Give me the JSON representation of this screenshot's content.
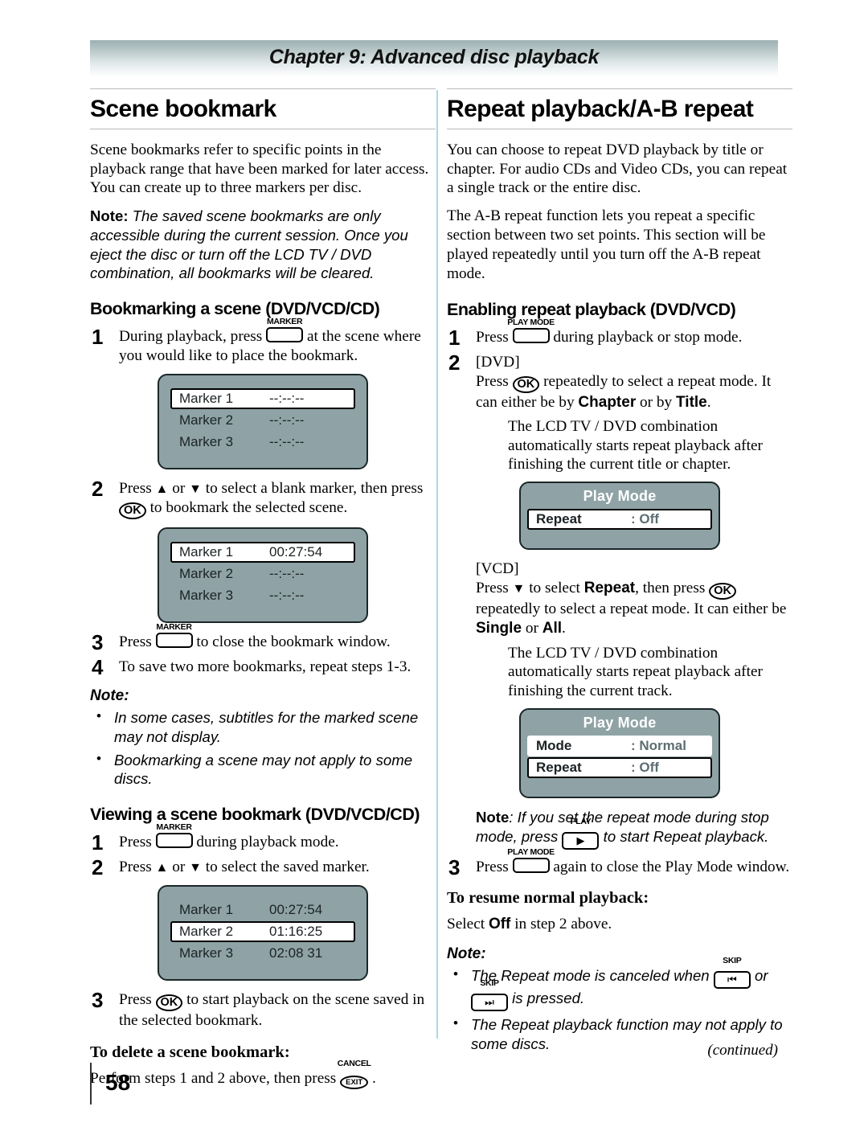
{
  "header": {
    "chapter_title": "Chapter 9: Advanced disc playback"
  },
  "footer": {
    "page_number": "58",
    "continued": "(continued)"
  },
  "left_column": {
    "section_title": "Scene bookmark",
    "intro_paragraph": "Scene bookmarks refer to specific points in the playback range that have been marked for later access. You can create up to three markers per disc.",
    "note_label": "Note:",
    "note_text": " The saved scene bookmarks are only accessible during the current session. Once you eject the disc or turn off the LCD TV / DVD combination, all bookmarks will be cleared.",
    "subsection_title": "Bookmarking a scene (DVD/VCD/CD)",
    "step1_num": "1",
    "step1_pre": "During playback, press ",
    "step1_key": "MARKER",
    "step1_post": " at the scene where you would like to place the bookmark.",
    "step2_num": "2",
    "step2_pre": "Press ",
    "step2_mid": " or ",
    "step2_post": " to select a blank marker, then press ",
    "step2_ok": "OK",
    "step2_tail": " to bookmark the selected scene.",
    "step3_num": "3",
    "step3_pre": "Press ",
    "step3_key": "MARKER",
    "step3_post": " to close the bookmark window.",
    "step4_num": "4",
    "step4_text": "To save two more bookmarks, repeat steps 1-3.",
    "note_heading": "Note:",
    "note_bullets": [
      "In some cases, subtitles for the marked scene may not display.",
      "Bookmarking a scene may not apply to some discs."
    ],
    "subsection2_title": "Viewing a scene bookmark (DVD/VCD/CD)",
    "v_step1_num": "1",
    "v_step1_pre": "Press ",
    "v_step1_key": "MARKER",
    "v_step1_post": " during playback mode.",
    "v_step2_num": "2",
    "v_step2_pre": "Press ",
    "v_step2_mid": " or ",
    "v_step2_post": " to select the saved marker.",
    "v_step3_num": "3",
    "v_step3_pre": "Press ",
    "v_step3_ok": "OK",
    "v_step3_post": " to start playback on the scene saved in the selected bookmark.",
    "delete_heading": "To delete a scene bookmark:",
    "delete_pre": "Perform steps 1 and 2 above, then press ",
    "delete_key_top": "CANCEL",
    "delete_key_label": "EXIT",
    "delete_post": " ."
  },
  "right_column": {
    "section_title": "Repeat playback/A-B repeat",
    "paragraph1": "You can choose to repeat DVD playback by title or chapter. For audio CDs and Video CDs, you can repeat a single track or the entire disc.",
    "paragraph2": "The A-B repeat function lets you repeat a specific section between two set points. This section will be played repeatedly until you turn off the A-B repeat mode.",
    "subsection_title": "Enabling repeat playback (DVD/VCD)",
    "step1_num": "1",
    "step1_pre": "Press ",
    "step1_key": "PLAY MODE",
    "step1_post": " during playback or stop mode.",
    "step2_num": "2",
    "step2_tag_dvd": "[DVD]",
    "step2_dvd_pre": "Press ",
    "step2_dvd_ok": "OK",
    "step2_dvd_mid": " repeatedly to select a repeat mode. It can either be by ",
    "step2_dvd_opt1": "Chapter",
    "step2_dvd_or": " or by ",
    "step2_dvd_opt2": "Title",
    "step2_dvd_end": ".",
    "dvd_indent": "The LCD TV / DVD combination automatically starts repeat playback after finishing the current title or chapter.",
    "step2_tag_vcd": "[VCD]",
    "step2_vcd_pre": "Press ",
    "step2_vcd_mid": " to select ",
    "step2_vcd_bold": "Repeat",
    "step2_vcd_then": ", then press ",
    "step2_vcd_ok": "OK",
    "step2_vcd_tail": " repeatedly to select a repeat mode. It can either be ",
    "step2_vcd_opt1": "Single",
    "step2_vcd_or": " or ",
    "step2_vcd_opt2": "All",
    "step2_vcd_end": ".",
    "vcd_indent": "The LCD TV / DVD combination automatically starts repeat playback after finishing the current track.",
    "note_label": "Note",
    "note_pre": ": If you set the repeat mode during stop mode, press ",
    "note_key_label": "PLAY",
    "note_key_glyph": "▶",
    "note_post": " to start Repeat playback.",
    "step3_num": "3",
    "step3_pre": "Press ",
    "step3_key": "PLAY MODE",
    "step3_post": " again to close the Play Mode window.",
    "resume_heading": "To resume normal playback:",
    "resume_pre": "Select ",
    "resume_bold": "Off",
    "resume_post": " in step 2 above.",
    "note_heading": "Note:",
    "note_bullet1_pre": "The Repeat mode is canceled when ",
    "note_bullet1_key1_label": "SKIP",
    "note_bullet1_key1_glyph": "⏮",
    "note_bullet1_mid": " or ",
    "note_bullet1_key2_label": "SKIP",
    "note_bullet1_key2_glyph": "⏭",
    "note_bullet1_post": " is pressed.",
    "note_bullet2": "The Repeat playback function may not apply to some discs."
  },
  "dialogs": {
    "marker_blank": {
      "rows": [
        {
          "label": "Marker 1",
          "value": "--:--:--",
          "selected": true
        },
        {
          "label": "Marker 2",
          "value": "--:--:--",
          "selected": false
        },
        {
          "label": "Marker 3",
          "value": "--:--:--",
          "selected": false
        }
      ]
    },
    "marker_one_set": {
      "rows": [
        {
          "label": "Marker 1",
          "value": "00:27:54",
          "selected": true
        },
        {
          "label": "Marker 2",
          "value": "--:--:--",
          "selected": false
        },
        {
          "label": "Marker 3",
          "value": "--:--:--",
          "selected": false
        }
      ]
    },
    "marker_all_set": {
      "rows": [
        {
          "label": "Marker 1",
          "value": "00:27:54",
          "selected": false
        },
        {
          "label": "Marker 2",
          "value": "01:16:25",
          "selected": true
        },
        {
          "label": "Marker 3",
          "value": "02:08 31",
          "selected": false
        }
      ]
    },
    "play_mode_dvd": {
      "title": "Play Mode",
      "rows": [
        {
          "label": "Repeat",
          "value": ": Off",
          "selected": true
        }
      ]
    },
    "play_mode_vcd": {
      "title": "Play Mode",
      "rows": [
        {
          "label": "Mode",
          "value": ": Normal",
          "selected": false
        },
        {
          "label": "Repeat",
          "value": ": Off",
          "selected": true
        }
      ]
    }
  },
  "colors": {
    "osd_background": "#8fa3a6",
    "osd_border": "#1b2628",
    "column_divider": "#a9dbe4",
    "banner_gradient_top": "#9db0b2"
  }
}
